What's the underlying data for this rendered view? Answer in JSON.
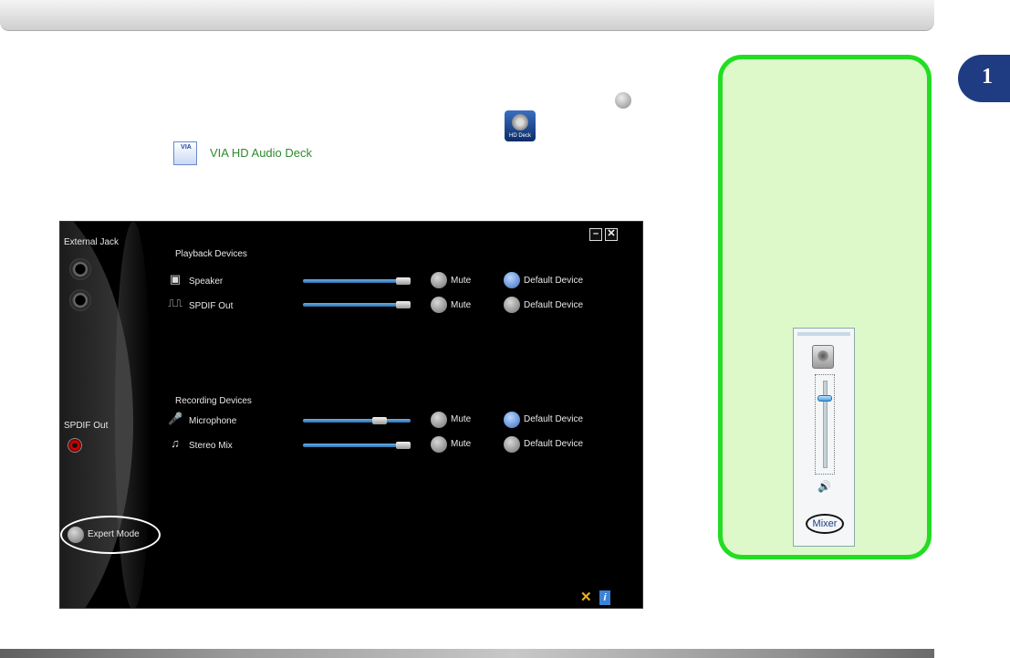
{
  "chapter": {
    "number": "1"
  },
  "inline": {
    "via_label": "VIA HD Audio Deck",
    "hd_icon_label": "HD Deck"
  },
  "deck": {
    "external_jack_label": "External Jack",
    "spdif_out_label": "SPDIF Out",
    "expert_mode_label": "Expert Mode",
    "minimize_label": "–",
    "close_label": "✕",
    "playback": {
      "section_label": "Playback Devices",
      "rows": [
        {
          "name": "Speaker",
          "volume": 0.95,
          "mute_label": "Mute",
          "default_label": "Default Device",
          "default_selected": true
        },
        {
          "name": "SPDIF Out",
          "volume": 0.95,
          "mute_label": "Mute",
          "default_label": "Default Device",
          "default_selected": false
        }
      ]
    },
    "recording": {
      "section_label": "Recording Devices",
      "rows": [
        {
          "name": "Microphone",
          "volume": 0.71,
          "mute_label": "Mute",
          "default_label": "Default Device",
          "default_selected": true
        },
        {
          "name": "Stereo Mix",
          "volume": 0.95,
          "mute_label": "Mute",
          "default_label": "Default Device",
          "default_selected": false
        }
      ]
    }
  },
  "volume_panel": {
    "mixer_label": "Mixer",
    "volume_level": 0.8
  },
  "colors": {
    "accent_green": "#22dd22",
    "chapter_blue": "#1f3c82",
    "selected_radio": "#3b6ec0"
  }
}
